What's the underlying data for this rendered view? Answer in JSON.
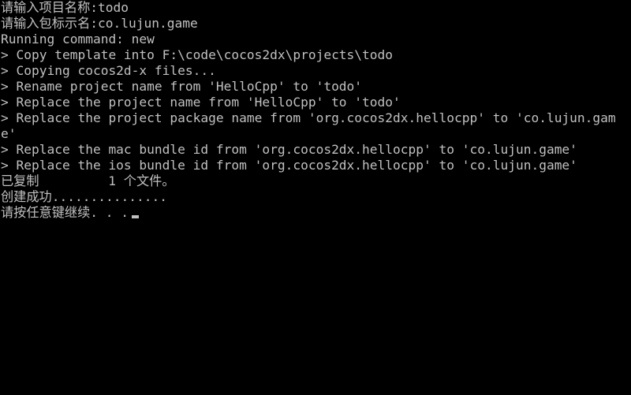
{
  "console": {
    "lines": [
      "请输入项目名称:todo",
      "请输入包标示名:co.lujun.game",
      "Running command: new",
      "> Copy template into F:\\code\\cocos2dx\\projects\\todo",
      "> Copying cocos2d-x files...",
      "> Rename project name from 'HelloCpp' to 'todo'",
      "> Replace the project name from 'HelloCpp' to 'todo'",
      "> Replace the project package name from 'org.cocos2dx.hellocpp' to 'co.lujun.gam",
      "e'",
      "> Replace the mac bundle id from 'org.cocos2dx.hellocpp' to 'co.lujun.game'",
      "> Replace the ios bundle id from 'org.cocos2dx.hellocpp' to 'co.lujun.game'",
      "已复制         1 个文件。",
      "创建成功...............",
      "请按任意键继续. . ."
    ]
  }
}
